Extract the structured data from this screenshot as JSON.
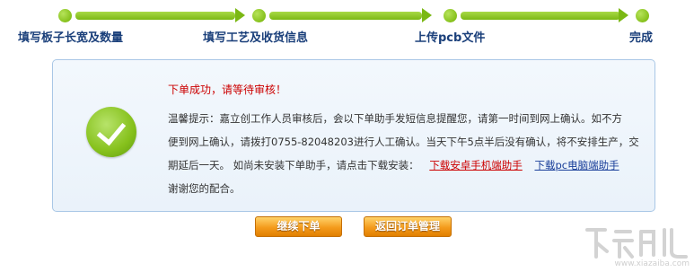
{
  "steps": [
    {
      "label": "填写板子长宽及数量"
    },
    {
      "label": "填写工艺及收货信息"
    },
    {
      "label": "上传pcb文件"
    },
    {
      "label": "完成"
    }
  ],
  "colors": {
    "progress_green": "#86c11c",
    "step_label": "#1a3f7a",
    "success_title": "#cc0000",
    "panel_border": "#a9c7e6",
    "button_orange": "#f49b1c",
    "link_android": "#cc0000",
    "link_pc": "#1a3f9a"
  },
  "message": {
    "icon": "check-icon",
    "title": "下单成功，请等待审核！",
    "line1": "温馨提示：嘉立创工作人员审核后，会以下单助手发短信息提醒您，请第一时间到网上确认。如不方",
    "line2": "便到网上确认，请拨打0755-82048203进行人工确认。当天下午5点半后没有确认，将不安排生产，交",
    "line3_prefix": "期延后一天。 如尚未安装下单助手，请点击下载安装：",
    "android_link": "下载安卓手机端助手",
    "pc_link": "下载pc电脑端助手",
    "line4": "谢谢您的配合。"
  },
  "buttons": {
    "continue": "继续下单",
    "back": "返回订单管理"
  },
  "watermark": {
    "text": "www.xiazaiba.com"
  }
}
